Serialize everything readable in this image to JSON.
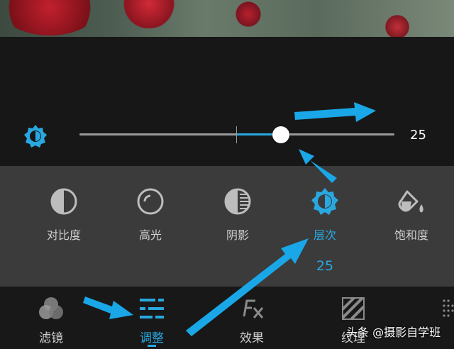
{
  "slider": {
    "value": "25",
    "level": 0.64
  },
  "tools": [
    {
      "label": "对比度",
      "icon": "contrast-icon",
      "active": false
    },
    {
      "label": "高光",
      "icon": "highlight-icon",
      "active": false
    },
    {
      "label": "阴影",
      "icon": "shadow-icon",
      "active": false
    },
    {
      "label": "层次",
      "icon": "structure-icon",
      "active": true
    },
    {
      "label": "饱和度",
      "icon": "saturation-icon",
      "active": false
    }
  ],
  "active_tool_value": "25",
  "bottom_nav": [
    {
      "label": "滤镜",
      "icon": "filter-icon",
      "active": false
    },
    {
      "label": "调整",
      "icon": "adjust-sliders-icon",
      "active": true
    },
    {
      "label": "效果",
      "icon": "fx-icon",
      "active": false
    },
    {
      "label": "纹理",
      "icon": "texture-icon",
      "active": false
    }
  ],
  "watermark": "头条 @摄影自学班",
  "colors": {
    "accent": "#29a8e0",
    "panel_dark": "#171717",
    "panel_gray": "#3b3b3b"
  }
}
